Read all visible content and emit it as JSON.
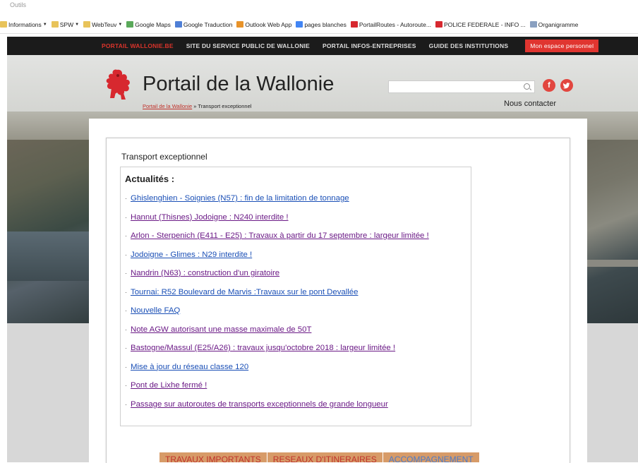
{
  "browser": {
    "menu_label": "Outils",
    "bookmarks": [
      {
        "label": "Informations",
        "icon": "folder-icon",
        "dropdown": true
      },
      {
        "label": "SPW",
        "icon": "folder-icon",
        "dropdown": true
      },
      {
        "label": "WebTeuv",
        "icon": "folder-icon",
        "dropdown": true
      },
      {
        "label": "Google Maps",
        "icon": "maps-icon",
        "dropdown": false
      },
      {
        "label": "Google Traduction",
        "icon": "translate-icon",
        "dropdown": false
      },
      {
        "label": "Outlook Web App",
        "icon": "outlook-icon",
        "dropdown": false
      },
      {
        "label": "pages blanches",
        "icon": "google-icon",
        "dropdown": false
      },
      {
        "label": "PortailRoutes - Autoroute...",
        "icon": "portail-icon",
        "dropdown": false
      },
      {
        "label": "POLICE FEDERALE - INFO ...",
        "icon": "police-icon",
        "dropdown": false
      },
      {
        "label": "Organigramme",
        "icon": "page-icon",
        "dropdown": false
      }
    ]
  },
  "topnav": {
    "items": [
      "PORTAIL WALLONIE.BE",
      "SITE DU SERVICE PUBLIC DE WALLONIE",
      "PORTAIL INFOS-ENTREPRISES",
      "GUIDE DES INSTITUTIONS"
    ],
    "personal_space": "Mon espace personnel"
  },
  "header": {
    "site_title": "Portail de la Wallonie",
    "breadcrumb_home": "Portail de la Wallonie",
    "breadcrumb_separator": " » ",
    "breadcrumb_current": "Transport exceptionnel",
    "search_placeholder": "",
    "contact": "Nous contacter",
    "social": [
      "f",
      "t"
    ]
  },
  "main": {
    "page_title": "Transport exceptionnel",
    "news_title": "Actualités :",
    "bullet": "·",
    "news": [
      {
        "text": "Ghislenghien - Soignies (N57) : fin de la limitation de tonnage",
        "visited": false
      },
      {
        "text": "Hannut (Thisnes) Jodoigne : N240 interdite !",
        "visited": true
      },
      {
        "text": "Arlon - Sterpenich (E411 - E25) : Travaux à partir du 17 septembre : largeur limitée !",
        "visited": true
      },
      {
        "text": "Jodoigne - Glimes : N29 interdite !",
        "visited": false
      },
      {
        "text": "Nandrin (N63) : construction d'un giratoire",
        "visited": true
      },
      {
        "text": "Tournai: R52 Boulevard de Marvis :Travaux sur le pont Devallée",
        "visited": false
      },
      {
        "text": "Nouvelle FAQ",
        "visited": false
      },
      {
        "text": "Note AGW autorisant une masse maximale de 50T",
        "visited": true
      },
      {
        "text": "Bastogne/Massul (E25/A26) : travaux jusqu'octobre 2018 : largeur limitée !",
        "visited": true
      },
      {
        "text": "Mise à jour du réseau classe 120",
        "visited": false
      },
      {
        "text": "Pont de Lixhe fermé !",
        "visited": true
      },
      {
        "text": "Passage sur autoroutes de transports exceptionnels de grande longueur",
        "visited": true
      }
    ],
    "tabs": [
      "TRAVAUX IMPORTANTS",
      "RESEAUX D'ITINERAIRES",
      "ACCOMPAGNEMENT"
    ]
  },
  "colors": {
    "accent_red": "#e03530",
    "link_visited": "#6b1a86",
    "link_unvisited": "#1a4fb6",
    "nav_bg": "#1b1b1b",
    "tab_bg": "#d79b68"
  }
}
